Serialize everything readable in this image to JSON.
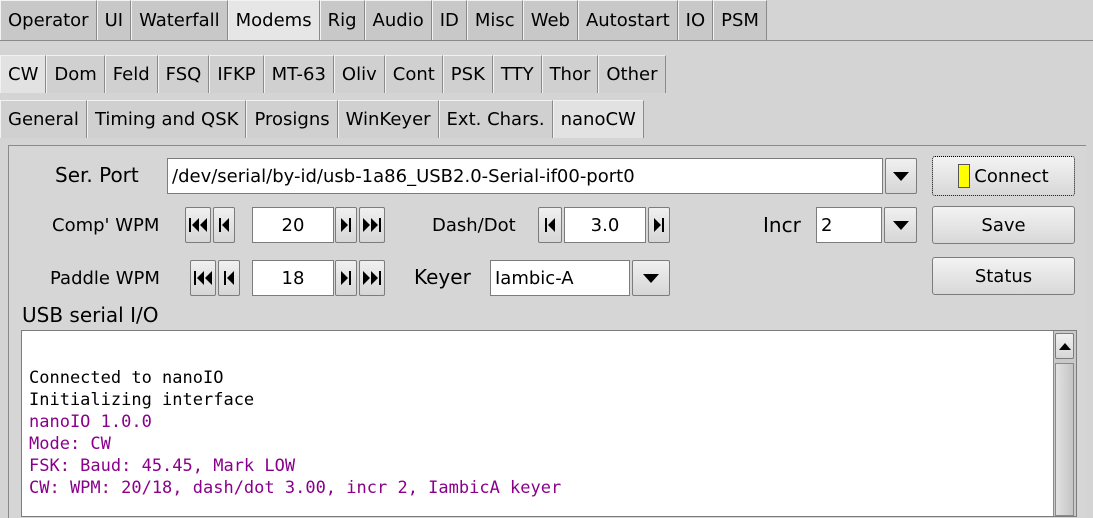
{
  "tabs_row1": [
    "Operator",
    "UI",
    "Waterfall",
    "Modems",
    "Rig",
    "Audio",
    "ID",
    "Misc",
    "Web",
    "Autostart",
    "IO",
    "PSM"
  ],
  "tabs_row1_active": "Modems",
  "tabs_row2": [
    "CW",
    "Dom",
    "Feld",
    "FSQ",
    "IFKP",
    "MT-63",
    "Oliv",
    "Cont",
    "PSK",
    "TTY",
    "Thor",
    "Other"
  ],
  "tabs_row2_active": "CW",
  "tabs_row3": [
    "General",
    "Timing and QSK",
    "Prosigns",
    "WinKeyer",
    "Ext. Chars.",
    "nanoCW"
  ],
  "tabs_row3_active": "nanoCW",
  "serial": {
    "label": "Ser. Port",
    "value": "/dev/serial/by-id/usb-1a86_USB2.0-Serial-if00-port0"
  },
  "buttons": {
    "connect": "Connect",
    "save": "Save",
    "status": "Status"
  },
  "comp_wpm": {
    "label": "Comp' WPM",
    "value": "20"
  },
  "dash_dot": {
    "label": "Dash/Dot",
    "value": "3.0"
  },
  "incr": {
    "label": "Incr",
    "value": "2"
  },
  "paddle_wpm": {
    "label": "Paddle WPM",
    "value": "18"
  },
  "keyer": {
    "label": "Keyer",
    "value": "Iambic-A"
  },
  "io": {
    "title": "USB serial I/O",
    "lines": [
      {
        "text": "Connected to nanoIO",
        "color": "#000000"
      },
      {
        "text": "Initializing interface",
        "color": "#000000"
      },
      {
        "text": "nanoIO 1.0.0",
        "color": "#8b008b"
      },
      {
        "text": "Mode: CW",
        "color": "#8b008b"
      },
      {
        "text": "FSK: Baud: 45.45, Mark LOW",
        "color": "#8b008b"
      },
      {
        "text": "CW: WPM: 20/18, dash/dot 3.00, incr 2, IambicA keyer",
        "color": "#8b008b"
      }
    ]
  },
  "colors": {
    "connect_indicator": "#ffff00",
    "received_text": "#8b008b"
  }
}
